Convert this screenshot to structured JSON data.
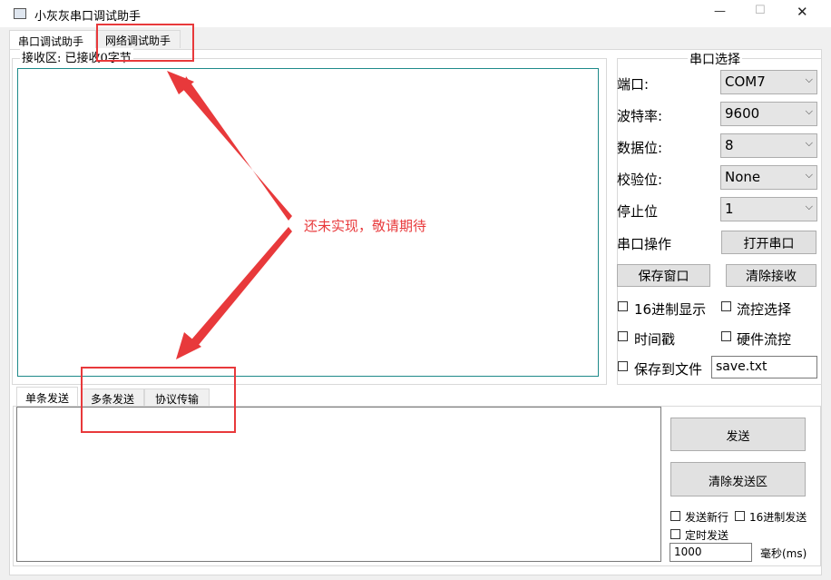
{
  "window": {
    "title": "小灰灰串口调试助手",
    "minimize_glyph": "—",
    "maximize_glyph": "☐",
    "close_glyph": "✕"
  },
  "main_tabs": [
    {
      "label": "串口调试助手"
    },
    {
      "label": "网络调试助手"
    }
  ],
  "receive": {
    "status": "接收区: 已接收0字节"
  },
  "serial": {
    "group_title": "串口选择",
    "port_label": "端口:",
    "port_value": "COM7",
    "baud_label": "波特率:",
    "baud_value": "9600",
    "databits_label": "数据位:",
    "databits_value": "8",
    "parity_label": "校验位:",
    "parity_value": "None",
    "stopbits_label": "停止位",
    "stopbits_value": "1",
    "operation_label": "串口操作",
    "open_button": "打开串口",
    "save_window_button": "保存窗口",
    "clear_receive_button": "清除接收",
    "hex_display": "16进制显示",
    "flow_control_select": "流控选择",
    "timestamp": "时间戳",
    "hardware_flow": "硬件流控",
    "save_to_file": "保存到文件",
    "save_filename": "save.txt"
  },
  "send_tabs": [
    {
      "label": "单条发送"
    },
    {
      "label": "多条发送"
    },
    {
      "label": "协议传输"
    }
  ],
  "send": {
    "send_button": "发送",
    "clear_send_button": "清除发送区",
    "newline": "发送新行",
    "hex_send": "16进制发送",
    "timed_send": "定时发送",
    "interval_value": "1000",
    "interval_unit": "毫秒(ms)"
  },
  "annotation": {
    "text": "还未实现，敬请期待",
    "color": "#e8393b"
  }
}
